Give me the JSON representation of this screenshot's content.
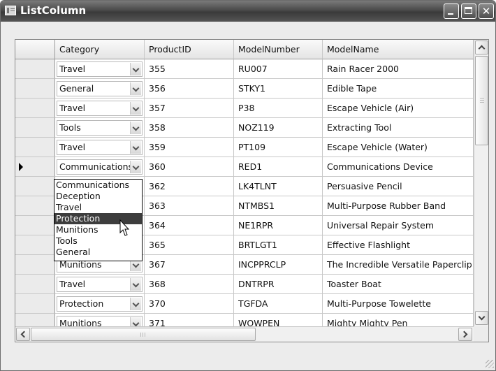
{
  "window": {
    "title": "ListColumn"
  },
  "titlebar_buttons": {
    "minimize": "minimize",
    "maximize": "maximize",
    "close": "✕"
  },
  "grid": {
    "columns": [
      "Category",
      "ProductID",
      "ModelNumber",
      "ModelName"
    ],
    "rows": [
      {
        "category": "Travel",
        "product_id": "355",
        "model_number": "RU007",
        "model_name": "Rain Racer 2000"
      },
      {
        "category": "General",
        "product_id": "356",
        "model_number": "STKY1",
        "model_name": "Edible Tape"
      },
      {
        "category": "Travel",
        "product_id": "357",
        "model_number": "P38",
        "model_name": "Escape Vehicle (Air)"
      },
      {
        "category": "Tools",
        "product_id": "358",
        "model_number": "NOZ119",
        "model_name": "Extracting Tool"
      },
      {
        "category": "Travel",
        "product_id": "359",
        "model_number": "PT109",
        "model_name": "Escape Vehicle (Water)"
      },
      {
        "category": "Communications",
        "product_id": "360",
        "model_number": "RED1",
        "model_name": "Communications Device",
        "current": true
      },
      {
        "category": "",
        "product_id": "362",
        "model_number": "LK4TLNT",
        "model_name": "Persuasive Pencil"
      },
      {
        "category": "",
        "product_id": "363",
        "model_number": "NTMBS1",
        "model_name": "Multi-Purpose Rubber Band"
      },
      {
        "category": "",
        "product_id": "364",
        "model_number": "NE1RPR",
        "model_name": "Universal Repair System"
      },
      {
        "category": "",
        "product_id": "365",
        "model_number": "BRTLGT1",
        "model_name": "Effective Flashlight"
      },
      {
        "category": "Munitions",
        "product_id": "367",
        "model_number": "INCPPRCLP",
        "model_name": "The Incredible Versatile Paperclip"
      },
      {
        "category": "Travel",
        "product_id": "368",
        "model_number": "DNTRPR",
        "model_name": "Toaster Boat"
      },
      {
        "category": "Protection",
        "product_id": "370",
        "model_number": "TGFDA",
        "model_name": "Multi-Purpose Towelette"
      },
      {
        "category": "Munitions",
        "product_id": "371",
        "model_number": "WOWPEN",
        "model_name": "Mighty Mighty Pen"
      }
    ]
  },
  "dropdown": {
    "options": [
      "Communications",
      "Deception",
      "Travel",
      "Protection",
      "Munitions",
      "Tools",
      "General"
    ],
    "highlighted": "Protection"
  },
  "colors": {
    "titlebar": "#4a4a4a",
    "selection": "#3d3d3d"
  }
}
